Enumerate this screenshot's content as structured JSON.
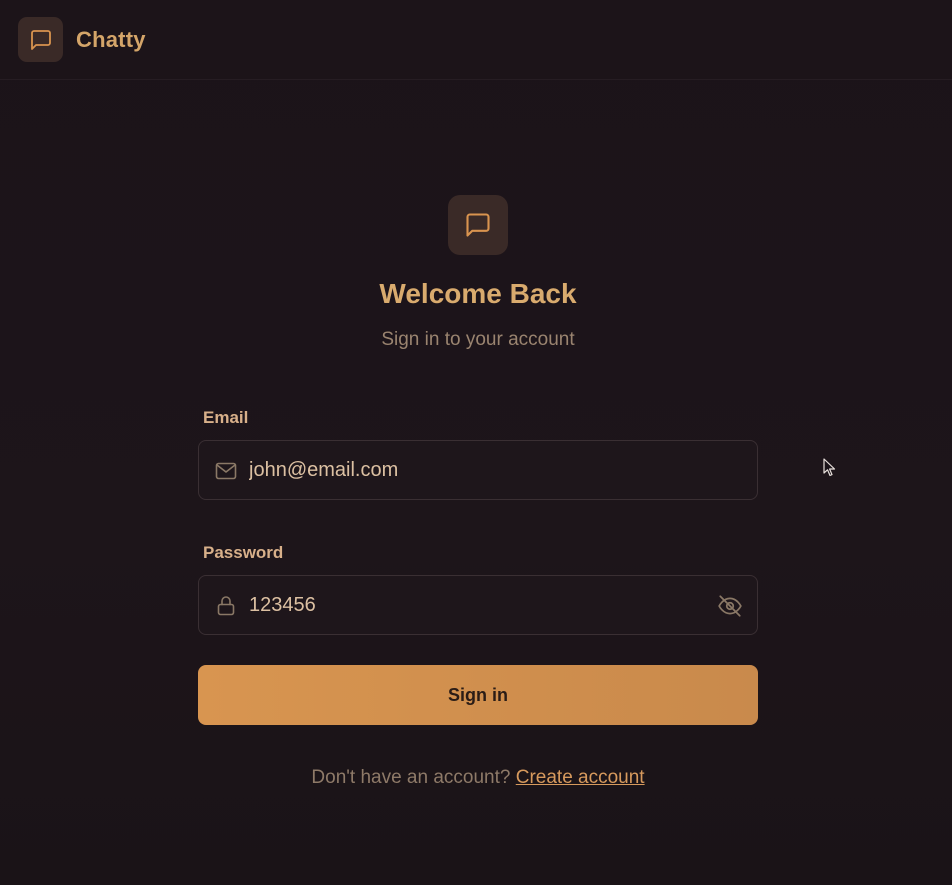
{
  "header": {
    "brand_name": "Chatty",
    "brand_icon": "message-square-icon"
  },
  "hero": {
    "icon": "message-square-icon",
    "title": "Welcome Back",
    "subtitle": "Sign in to your account"
  },
  "form": {
    "email": {
      "label": "Email",
      "value": "john@email.com",
      "icon": "mail-icon"
    },
    "password": {
      "label": "Password",
      "value": "123456",
      "icon": "lock-icon",
      "toggle_icon": "eye-off-icon"
    },
    "submit_label": "Sign in"
  },
  "footer": {
    "prompt": "Don't have an account?",
    "link_label": "Create account"
  },
  "colors": {
    "background": "#1b1319",
    "accent": "#d4a569",
    "button": "#d89550",
    "icon_bg": "#3a2a27"
  }
}
